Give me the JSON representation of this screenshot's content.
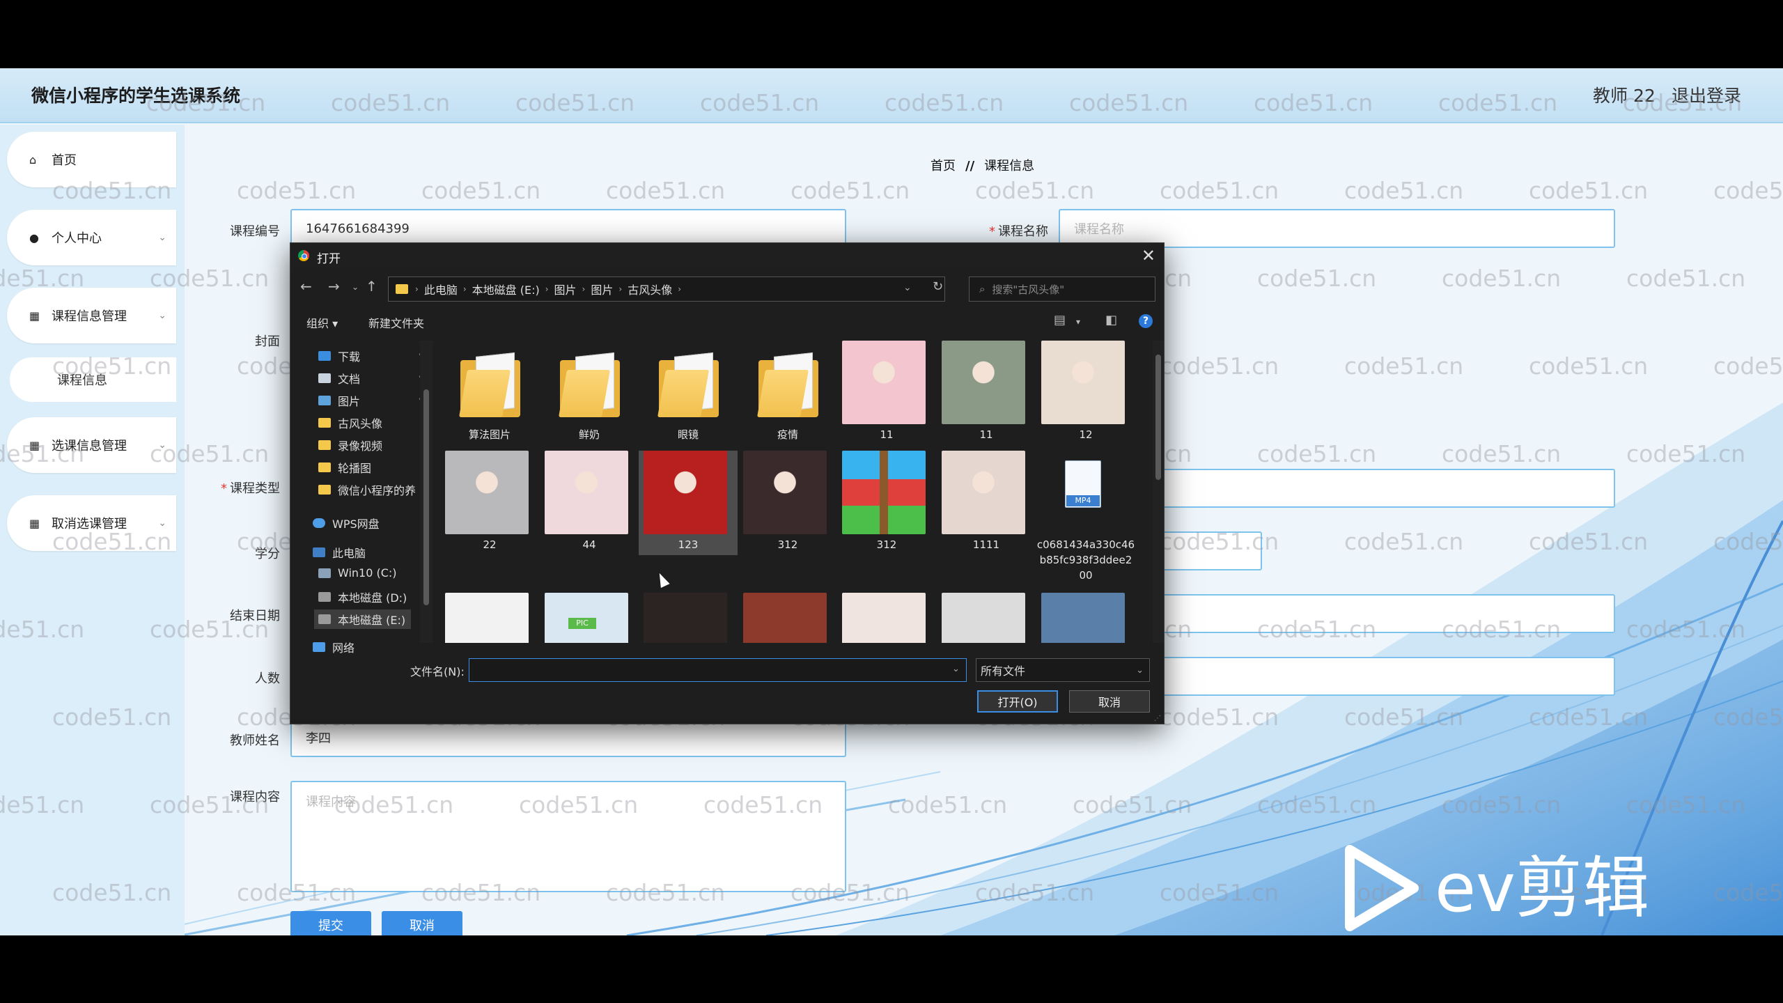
{
  "header": {
    "title": "微信小程序的学生选课系统",
    "user": "教师 22",
    "logout": "退出登录"
  },
  "sidebar": {
    "items": [
      {
        "label": "首页",
        "icon": "home-icon"
      },
      {
        "label": "个人中心",
        "icon": "user-icon"
      },
      {
        "label": "课程信息管理",
        "icon": "grid-icon"
      },
      {
        "label": "课程信息"
      },
      {
        "label": "选课信息管理",
        "icon": "grid-icon"
      },
      {
        "label": "取消选课管理",
        "icon": "grid-icon"
      }
    ]
  },
  "breadcrumb": {
    "home": "首页",
    "sep": "//",
    "current": "课程信息"
  },
  "form": {
    "labels": {
      "code": "课程编号",
      "name": "课程名称",
      "cover": "封面",
      "type": "课程类型",
      "credit": "学分",
      "end_date": "结束日期",
      "count": "人数",
      "teacher": "教师姓名",
      "content": "课程内容"
    },
    "required_mark": "*",
    "code_value": "1647661684399",
    "name_placeholder": "课程名称",
    "teacher_value": "李四",
    "content_placeholder": "课程内容",
    "submit": "提交",
    "cancel": "取消"
  },
  "watermark": "code51.cn",
  "dialog": {
    "title": "打开",
    "path": [
      "此电脑",
      "本地磁盘 (E:)",
      "图片",
      "图片",
      "古风头像"
    ],
    "search_placeholder": "搜索\"古风头像\"",
    "organize": "组织 ▾",
    "new_folder": "新建文件夹",
    "nav": {
      "quick": [
        {
          "label": "下载",
          "icon": "download-icon"
        },
        {
          "label": "文档",
          "icon": "document-icon"
        },
        {
          "label": "图片",
          "icon": "picture-icon"
        },
        {
          "label": "古风头像",
          "icon": "folder-icon"
        },
        {
          "label": "录像视频",
          "icon": "folder-icon"
        },
        {
          "label": "轮播图",
          "icon": "folder-icon"
        },
        {
          "label": "微信小程序的养",
          "icon": "folder-icon"
        }
      ],
      "wps": "WPS网盘",
      "pc": "此电脑",
      "drives": [
        "Win10 (C:)",
        "本地磁盘 (D:)",
        "本地磁盘 (E:)"
      ],
      "network": "网络"
    },
    "files": [
      {
        "label": "算法图片",
        "kind": "folder"
      },
      {
        "label": "鲜奶",
        "kind": "folder"
      },
      {
        "label": "眼镜",
        "kind": "folder"
      },
      {
        "label": "疫情",
        "kind": "folder"
      },
      {
        "label": "11",
        "kind": "image",
        "color": "#f3c6cf"
      },
      {
        "label": "11",
        "kind": "image",
        "color": "#8a9a86"
      },
      {
        "label": "12",
        "kind": "image",
        "color": "#e9ddd2"
      },
      {
        "label": "22",
        "kind": "image",
        "color": "#b9b9bb"
      },
      {
        "label": "44",
        "kind": "image",
        "color": "#f0d9dc"
      },
      {
        "label": "123",
        "kind": "image",
        "color": "#b8201f"
      },
      {
        "label": "312",
        "kind": "image",
        "color": "#3b2a2c"
      },
      {
        "label": "312",
        "kind": "archive",
        "color": "#2ea7e8"
      },
      {
        "label": "1111",
        "kind": "image",
        "color": "#e5d6d0"
      },
      {
        "label": "c0681434a330c46b85fc938f3ddee200",
        "kind": "mp4",
        "badge": "MP4"
      }
    ],
    "row3_colors": [
      "#f2f2f2",
      "#d9e7f2",
      "#2c2422",
      "#8d3a2d",
      "#efe4e0",
      "#dcdcdc",
      "#5a7fa8"
    ],
    "row3_badge": "PIC",
    "file_name_label": "文件名(N):",
    "file_type": "所有文件",
    "open": "打开(O)",
    "cancel": "取消"
  },
  "ev": {
    "brand": "ev剪辑"
  }
}
